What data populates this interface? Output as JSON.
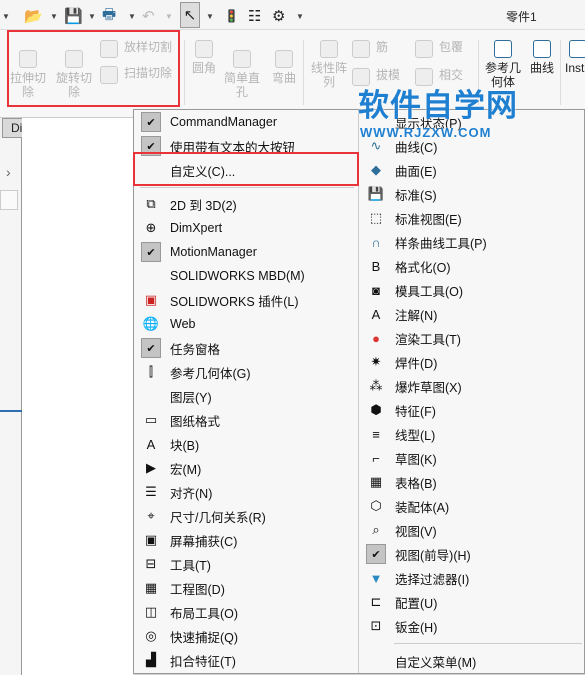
{
  "window": {
    "title": "零件1"
  },
  "ribbon": {
    "items": [
      "拉伸切除",
      "旋转切除",
      "放样切割",
      "扫描切除",
      "圆角",
      "简单直孔",
      "弯曲",
      "线性阵列",
      "筋",
      "拔模",
      "包覆",
      "相交",
      "参考几何体",
      "曲线",
      "Insta"
    ]
  },
  "tabs": {
    "dimxpert": "DimXpert"
  },
  "menu": {
    "left": [
      {
        "label": "CommandManager",
        "icon": "check",
        "checked": true
      },
      {
        "label": "使用带有文本的大按钮",
        "icon": "check",
        "checked": true
      },
      {
        "label": "自定义(C)...",
        "icon": "none",
        "highlighted": true
      },
      {
        "label": "2D 到 3D(2)",
        "icon": "2d-to-3d-icon"
      },
      {
        "label": "DimXpert",
        "icon": "crosshair-icon"
      },
      {
        "label": "MotionManager",
        "icon": "check",
        "checked": true
      },
      {
        "label": "SOLIDWORKS MBD(M)",
        "icon": "none"
      },
      {
        "label": "SOLIDWORKS 插件(L)",
        "icon": "addin-icon"
      },
      {
        "label": "Web",
        "icon": "globe-icon"
      },
      {
        "label": "任务窗格",
        "icon": "check",
        "checked": true
      },
      {
        "label": "参考几何体(G)",
        "icon": "reference-geometry-icon"
      },
      {
        "label": "图层(Y)",
        "icon": "none"
      },
      {
        "label": "图纸格式",
        "icon": "sheet-format-icon"
      },
      {
        "label": "块(B)",
        "icon": "block-icon"
      },
      {
        "label": "宏(M)",
        "icon": "macro-icon"
      },
      {
        "label": "对齐(N)",
        "icon": "align-icon"
      },
      {
        "label": "尺寸/几何关系(R)",
        "icon": "dimension-icon"
      },
      {
        "label": "屏幕捕获(C)",
        "icon": "screen-capture-icon"
      },
      {
        "label": "工具(T)",
        "icon": "toolbox-icon"
      },
      {
        "label": "工程图(D)",
        "icon": "drawing-icon"
      },
      {
        "label": "布局工具(O)",
        "icon": "layout-tools-icon"
      },
      {
        "label": "快速捕捉(Q)",
        "icon": "quick-snap-icon"
      },
      {
        "label": "扣合特征(T)",
        "icon": "fastening-feature-icon"
      }
    ],
    "right": [
      {
        "label": "显示状态(P)",
        "icon": "none"
      },
      {
        "label": "曲线(C)",
        "icon": "curve-icon"
      },
      {
        "label": "曲面(E)",
        "icon": "surface-icon"
      },
      {
        "label": "标准(S)",
        "icon": "save-icon"
      },
      {
        "label": "标准视图(E)",
        "icon": "standard-views-icon"
      },
      {
        "label": "样条曲线工具(P)",
        "icon": "spline-icon"
      },
      {
        "label": "格式化(O)",
        "icon": "format-icon"
      },
      {
        "label": "模具工具(O)",
        "icon": "mold-tools-icon"
      },
      {
        "label": "注解(N)",
        "icon": "annotation-icon"
      },
      {
        "label": "渲染工具(T)",
        "icon": "render-icon"
      },
      {
        "label": "焊件(D)",
        "icon": "weldment-icon"
      },
      {
        "label": "爆炸草图(X)",
        "icon": "explode-sketch-icon"
      },
      {
        "label": "特征(F)",
        "icon": "features-icon"
      },
      {
        "label": "线型(L)",
        "icon": "line-format-icon"
      },
      {
        "label": "草图(K)",
        "icon": "sketch-icon"
      },
      {
        "label": "表格(B)",
        "icon": "table-icon"
      },
      {
        "label": "装配体(A)",
        "icon": "assembly-icon"
      },
      {
        "label": "视图(V)",
        "icon": "view-icon"
      },
      {
        "label": "视图(前导)(H)",
        "icon": "check",
        "checked": true
      },
      {
        "label": "选择过滤器(I)",
        "icon": "selection-filter-icon"
      },
      {
        "label": "配置(U)",
        "icon": "configuration-icon"
      },
      {
        "label": "钣金(H)",
        "icon": "sheet-metal-icon"
      }
    ],
    "footer": "自定义菜单(M)"
  },
  "watermark": {
    "line1": "软件自学网",
    "line2": "WWW.RJZXW.COM"
  },
  "colors": {
    "highlight_box": "#e8333a",
    "watermark": "#1f7fd0",
    "accent": "#2d6e9a"
  }
}
